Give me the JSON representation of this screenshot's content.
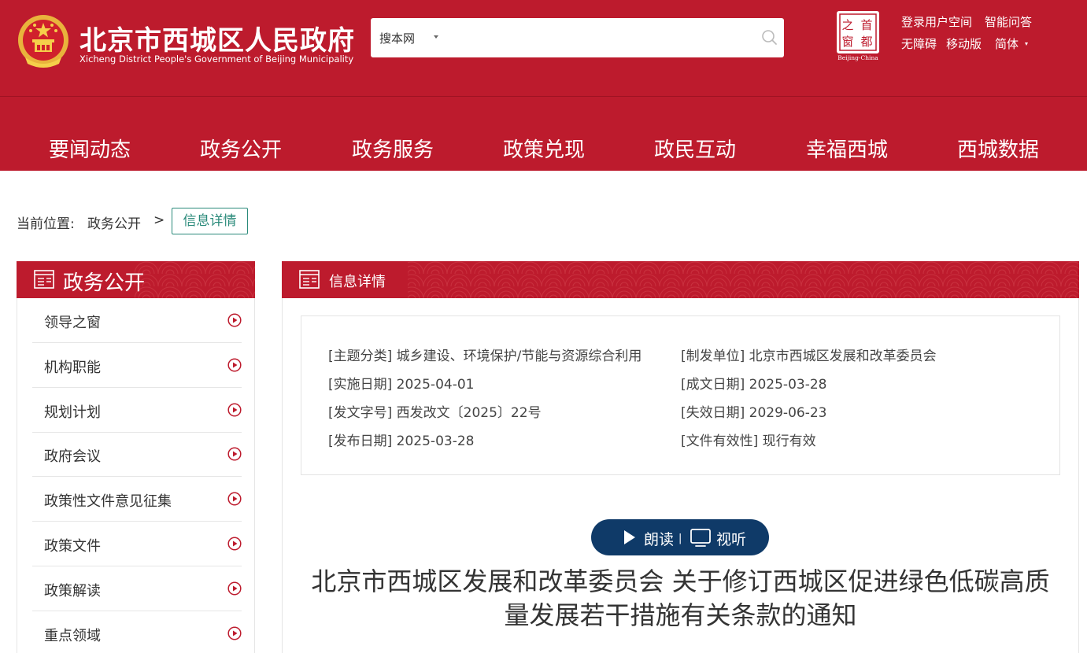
{
  "header": {
    "title_cn": "北京市西城区人民政府",
    "title_en": "Xicheng District People's Government of Beijing Municipality",
    "search": {
      "scope": "搜本网",
      "placeholder": ""
    },
    "beijing_logo_text": "Beijing-China",
    "beijing_logo_chars": [
      "之",
      "首",
      "窗",
      "都"
    ],
    "links": {
      "login": "登录用户空间",
      "smart_qa": "智能问答",
      "accessibility": "无障碍",
      "mobile": "移动版",
      "language": "简体"
    }
  },
  "nav": [
    "要闻动态",
    "政务公开",
    "政务服务",
    "政策兑现",
    "政民互动",
    "幸福西城",
    "西城数据"
  ],
  "breadcrumb": {
    "prefix": "当前位置:",
    "level1": "政务公开",
    "separator": ">",
    "current": "信息详情"
  },
  "sidebar": {
    "title": "政务公开",
    "items": [
      "领导之窗",
      "机构职能",
      "规划计划",
      "政府会议",
      "政策性文件意见征集",
      "政策文件",
      "政策解读",
      "重点领域"
    ]
  },
  "main": {
    "panel_title": "信息详情",
    "meta": [
      {
        "key": "[主题分类]",
        "value": "城乡建设、环境保护/节能与资源综合利用"
      },
      {
        "key": "[制发单位]",
        "value": "北京市西城区发展和改革委员会"
      },
      {
        "key": "[实施日期]",
        "value": "2025-04-01"
      },
      {
        "key": "[成文日期]",
        "value": "2025-03-28"
      },
      {
        "key": "[发文字号]",
        "value": "西发改文〔2025〕22号"
      },
      {
        "key": "[失效日期]",
        "value": "2029-06-23"
      },
      {
        "key": "[发布日期]",
        "value": "2025-03-28"
      },
      {
        "key": "[文件有效性]",
        "value": "现行有效"
      }
    ],
    "read_label": "朗读",
    "read_separator": "|",
    "view_label": "视听",
    "article_title": "北京市西城区发展和改革委员会 关于修订西城区促进绿色低碳高质量发展若干措施有关条款的通知"
  },
  "colors": {
    "brand_red": "#bd1b2d",
    "navy": "#0f3a68",
    "teal": "#2a8a7a"
  }
}
